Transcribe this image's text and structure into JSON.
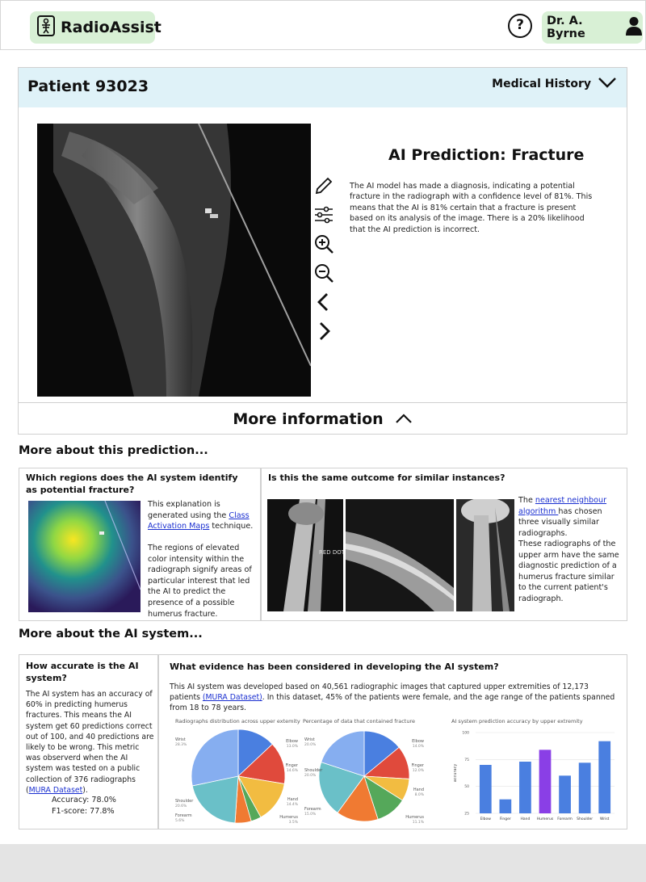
{
  "app": {
    "name": "RadioAssist",
    "user": "Dr. A. Byrne",
    "help_label": "?"
  },
  "patient": {
    "title": "Patient 93023",
    "medical_history_label": "Medical History"
  },
  "prediction": {
    "title": "AI Prediction: Fracture",
    "text": "The AI model has made a diagnosis, indicating a potential fracture in the radiograph with a confidence level of 81%. This means that the AI is 81% certain that a fracture is present based on its analysis of the image. There is a 20% likelihood that the AI prediction is incorrect."
  },
  "tools": [
    "pencil-icon",
    "sliders-icon",
    "zoom-in-icon",
    "zoom-out-icon",
    "chevron-left-icon",
    "chevron-right-icon"
  ],
  "more_info_label": "More information",
  "section1": {
    "title": "More about this prediction...",
    "regions": {
      "question": "Which regions does the AI system identify as potential fracture?",
      "p1_before": "This explanation is generated using the ",
      "p1_link": "Class Activation Maps",
      "p1_after": " technique.",
      "p2": "The regions of elevated color intensity within the radiograph signify areas of particular interest that led the AI to predict the presence of a possible humerus fracture."
    },
    "similar": {
      "question": "Is this the same outcome for similar instances?",
      "p1_before": "The ",
      "p1_link": "nearest neighbour algorithm ",
      "p1_after": "has chosen three visually similar radiographs.",
      "p2": "These radiographs of the upper arm have the same diagnostic prediction of a humerus fracture similar to the current patient's radiograph.",
      "image_label": "RED DOT"
    }
  },
  "section2": {
    "title": "More about the AI system...",
    "accuracy": {
      "question": "How accurate is the AI system?",
      "text_before": "The AI system has an accuracy of 60% in predicting humerus fractures. This means the AI system get 60 predictions correct out of 100, and 40 predictions are likely to be wrong. This metric  was observerd when the AI system was tested on a public collection of 376 radiographs (",
      "text_link": "MURA Dataset",
      "text_after": ").",
      "accuracy_line": "Accuracy: 78.0%",
      "f1_line": "F1-score: 77.8%"
    },
    "evidence": {
      "question": "What evidence has been considered in developing the AI system?",
      "text_before": "This AI system was developed based on 40,561 radiographic images that captured upper extremities of 12,173 patients ",
      "text_link": "(MURA Dataset)",
      "text_after": ". In this dataset, 45% of the patients were female, and the age range of the patients spanned from 18 to 78 years."
    }
  },
  "chart_data": [
    {
      "type": "pie",
      "title": "Radiographs distribution across upper extemity",
      "categories": [
        "Elbow",
        "Finger",
        "Hand",
        "Humerus",
        "Forearm",
        "Shoulder",
        "Wrist"
      ],
      "values": [
        13.0,
        14.6,
        14.4,
        3.5,
        5.6,
        20.6,
        28.3
      ],
      "labels": [
        "13.0%",
        "14.6%",
        "14.4%",
        "3.5%",
        "5.6%",
        "20.6%",
        "28.3%"
      ],
      "colors": [
        "#4a7fe0",
        "#e04a3c",
        "#f2bc41",
        "#55a85a",
        "#f07a32",
        "#6ac0c8",
        "#86aef0"
      ]
    },
    {
      "type": "pie",
      "title": "Percentage of data that contained fracture",
      "categories": [
        "Elbow",
        "Finger",
        "Hand",
        "Humerus",
        "Forearm",
        "Shoulder",
        "Wrist"
      ],
      "values": [
        14.0,
        12.0,
        8.0,
        11.1,
        15.0,
        20.0,
        20.0
      ],
      "labels": [
        "14.0%",
        "12.0%",
        "8.0%",
        "11.1%",
        "15.0%",
        "20.0%",
        "20.0%"
      ],
      "colors": [
        "#4a7fe0",
        "#e04a3c",
        "#f2bc41",
        "#55a85a",
        "#f07a32",
        "#6ac0c8",
        "#86aef0"
      ]
    },
    {
      "type": "bar",
      "title": "AI system prediction accuracy by upper extremity",
      "categories": [
        "Elbow",
        "Finger",
        "Hand",
        "Humerus",
        "Forearm",
        "Shoulder",
        "Wrist"
      ],
      "values": [
        70,
        38,
        73,
        84,
        60,
        72,
        92
      ],
      "ylabel": "accuracy",
      "ylim": [
        25,
        100
      ],
      "yticks": [
        25,
        50,
        75,
        100
      ],
      "colors": [
        "#4a7fe0",
        "#4a7fe0",
        "#4a7fe0",
        "#8a3fe6",
        "#4a7fe0",
        "#4a7fe0",
        "#4a7fe0"
      ]
    }
  ]
}
